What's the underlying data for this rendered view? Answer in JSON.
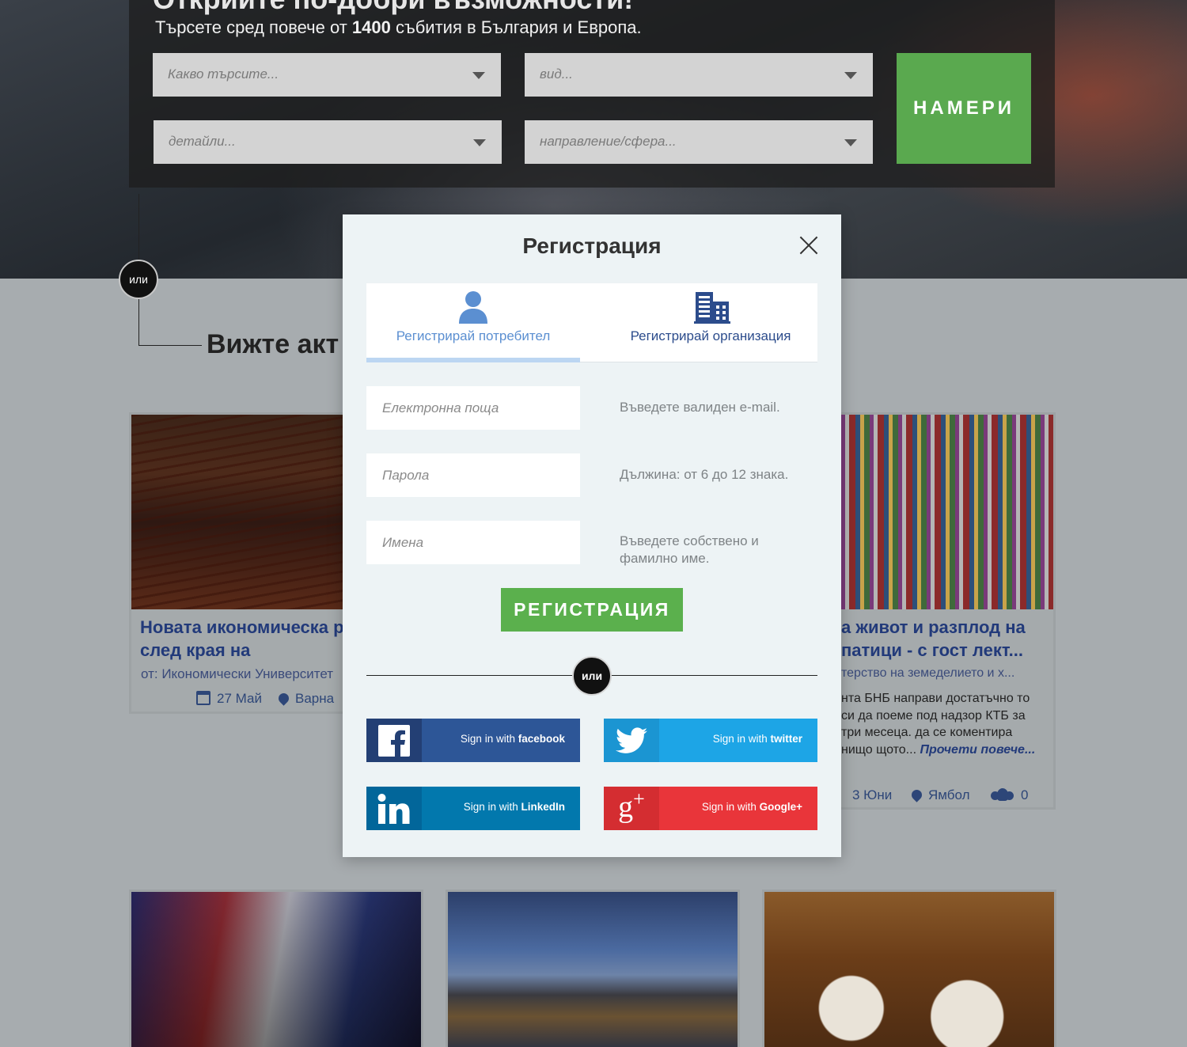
{
  "hero": {
    "title": "Открийте по-добри възможности!",
    "subtitle_prefix": "Търсете сред повече от ",
    "subtitle_count": "1400",
    "subtitle_suffix": " събития в България и Европа.",
    "selects": [
      {
        "placeholder": "Какво търсите..."
      },
      {
        "placeholder": "вид..."
      },
      {
        "placeholder": "детайли..."
      },
      {
        "placeholder": "направление/сфера..."
      }
    ],
    "find_button": "НАМЕРИ"
  },
  "page": {
    "or_label": "или",
    "section_title": "Вижте акт"
  },
  "cards": [
    {
      "title": "Новата икономическа реалност след края на",
      "org": "от: Икономически Университет",
      "date": "27 Май",
      "location": "Варна"
    },
    {
      "title": "а живот и разплод на патици - с гост лект...",
      "org": "терство на земеделието и х...",
      "desc": "нта БНБ направи достатъчно то си да поеме под надзор КТБ за три месеца. да се коментира нищо щото...",
      "readmore": "Прочети повече...",
      "date": "3 Юни",
      "location": "Ямбол",
      "attendees": "0"
    }
  ],
  "modal": {
    "title": "Регистрация",
    "tabs": [
      {
        "label": "Регистрирай потребител",
        "active": true
      },
      {
        "label": "Регистрирай организация",
        "active": false
      }
    ],
    "fields": [
      {
        "placeholder": "Електронна поща",
        "value": "",
        "hint": "Въведете валиден e-mail."
      },
      {
        "placeholder": "Парола",
        "value": "",
        "hint": "Дължина: от 6 до 12 знака."
      },
      {
        "placeholder": "Имена",
        "value": "",
        "hint": "Въведете собствено и фамилно име."
      }
    ],
    "submit": "РЕГИСТРАЦИЯ",
    "or_label": "или",
    "social": [
      {
        "prefix": "Sign in with ",
        "brand": "facebook",
        "icon": "facebook-icon",
        "color": "#2d5697"
      },
      {
        "prefix": "Sign in with ",
        "brand": "twitter",
        "icon": "twitter-icon",
        "color": "#1da5e6"
      },
      {
        "prefix": "Sign in with ",
        "brand": "LinkedIn",
        "icon": "linkedin-icon",
        "color": "#0278ad"
      },
      {
        "prefix": "Sign in with ",
        "brand": "Google+",
        "icon": "google-plus-icon",
        "color": "#e9353a"
      }
    ]
  },
  "colors": {
    "accent_green": "#5bb04d",
    "tab_active": "#5b8fd1",
    "link_blue": "#2c4c8c"
  }
}
